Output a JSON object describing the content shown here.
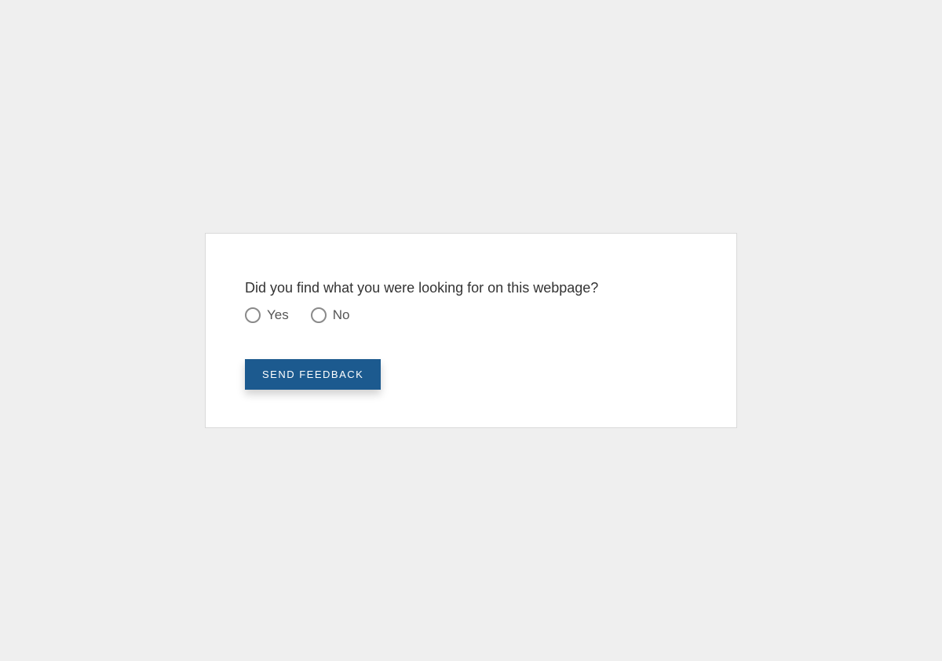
{
  "feedback": {
    "question": "Did you find what you were looking for on this webpage?",
    "options": {
      "yes": "Yes",
      "no": "No"
    },
    "submit_label": "SEND FEEDBACK"
  }
}
